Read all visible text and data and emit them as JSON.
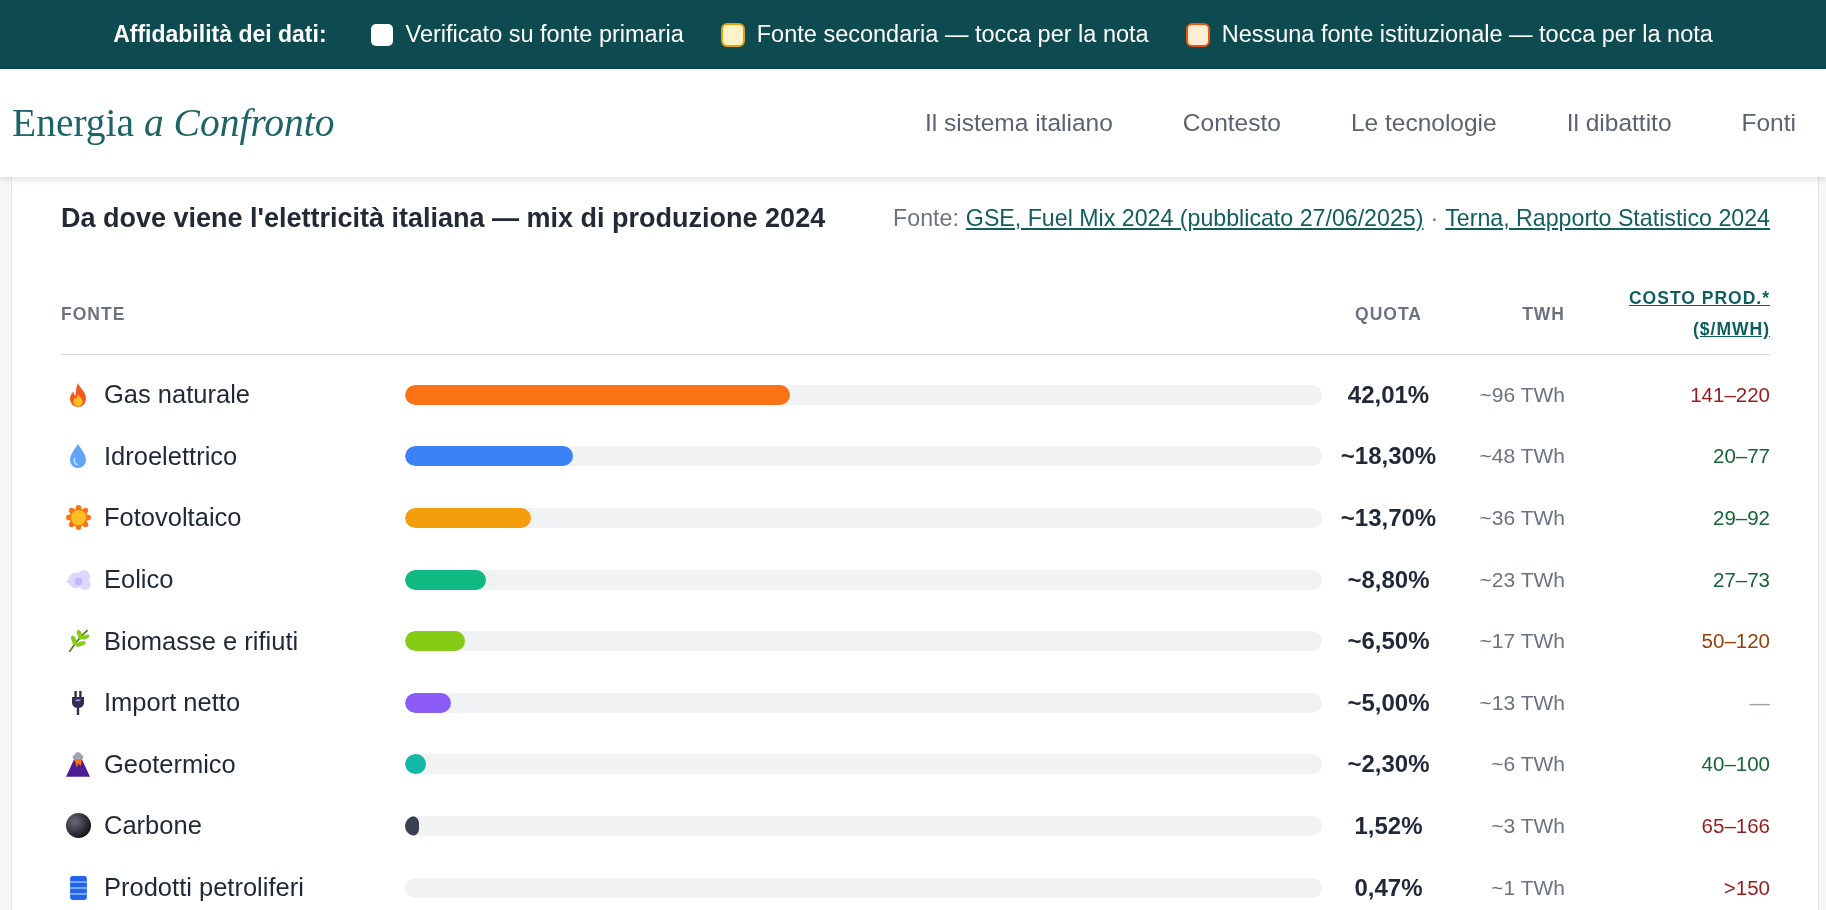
{
  "reliability_bar": {
    "label": "Affidabilità dei dati:",
    "items": [
      {
        "text": "Verificato su fonte primaria",
        "color": "#ffffff"
      },
      {
        "text": "Fonte secondaria — tocca per la nota",
        "color": "#fef3c7",
        "border": {
          "color": "#e3a008"
        }
      },
      {
        "text": "Nessuna fonte istituzionale — tocca per la nota",
        "color": "#ffedd5",
        "border": {
          "color": "#ea580c"
        }
      }
    ]
  },
  "header": {
    "logo": "Energia *a Confronto*",
    "nav": [
      {
        "label": "Il sistema italiano",
        "selected": false
      },
      {
        "label": "Contesto",
        "selected": false
      },
      {
        "label": "Le tecnologie",
        "selected": false
      },
      {
        "label": "Il dibattito",
        "selected": false
      },
      {
        "label": "Fonti",
        "selected": false
      }
    ]
  },
  "card": {
    "title": "Da dove viene l'elettricità italiana — mix di produzione 2024",
    "source": {
      "label": "Fonte:",
      "separator": "·",
      "links": [
        "GSE, Fuel Mix 2024 (pubblicato 27/06/2025)",
        "Terna, Rapporto Statistico 2024"
      ]
    }
  },
  "table": {
    "columns": [
      {
        "label": "FONTE",
        "kind": "text"
      },
      {
        "label": "QUOTA",
        "kind": "text"
      },
      {
        "label": "TWH",
        "kind": "text"
      },
      {
        "label": "COSTO PROD.*",
        "unit": "($/MWH)",
        "kind": "link"
      }
    ],
    "rows": [
      {
        "name": "Gas naturale",
        "level": 0.4201,
        "color": "#f97316",
        "share": "42,01%",
        "twh": "~96 TWh",
        "cost": {
          "text": "141–220",
          "color": "#991b1b"
        }
      },
      {
        "name": "Idroelettrico",
        "level": 0.183,
        "color": "#3b82f6",
        "share": "~18,30%",
        "twh": "~48 TWh",
        "cost": {
          "text": "20–77",
          "color": "#166534"
        }
      },
      {
        "name": "Fotovoltaico",
        "level": 0.137,
        "color": "#f59e0b",
        "share": "~13,70%",
        "twh": "~36 TWh",
        "cost": {
          "text": "29–92",
          "color": "#166534"
        }
      },
      {
        "name": "Eolico",
        "level": 0.088,
        "color": "#10b981",
        "share": "~8,80%",
        "twh": "~23 TWh",
        "cost": {
          "text": "27–73",
          "color": "#166534"
        }
      },
      {
        "name": "Biomasse e rifiuti",
        "level": 0.065,
        "color": "#84cc16",
        "share": "~6,50%",
        "twh": "~17 TWh",
        "cost": {
          "text": "50–120",
          "color": "#92400e"
        }
      },
      {
        "name": "Import netto",
        "level": 0.05,
        "color": "#8b5cf6",
        "share": "~5,00%",
        "twh": "~13 TWh",
        "cost": {
          "text": "—",
          "color": "#9ca3af"
        }
      },
      {
        "name": "Geotermico",
        "level": 0.023,
        "color": "#14b8a6",
        "share": "~2,30%",
        "twh": "~6 TWh",
        "cost": {
          "text": "40–100",
          "color": "#166534"
        }
      },
      {
        "name": "Carbone",
        "level": 0.0152,
        "color": "#374151",
        "share": "1,52%",
        "twh": "~3 TWh",
        "cost": {
          "text": "65–166",
          "color": "#991b1b"
        }
      },
      {
        "name": "Prodotti petroliferi",
        "share": "0,47%",
        "twh": "~1 TWh",
        "cost": {
          "text": ">150",
          "color": "#991b1b"
        }
      }
    ]
  }
}
